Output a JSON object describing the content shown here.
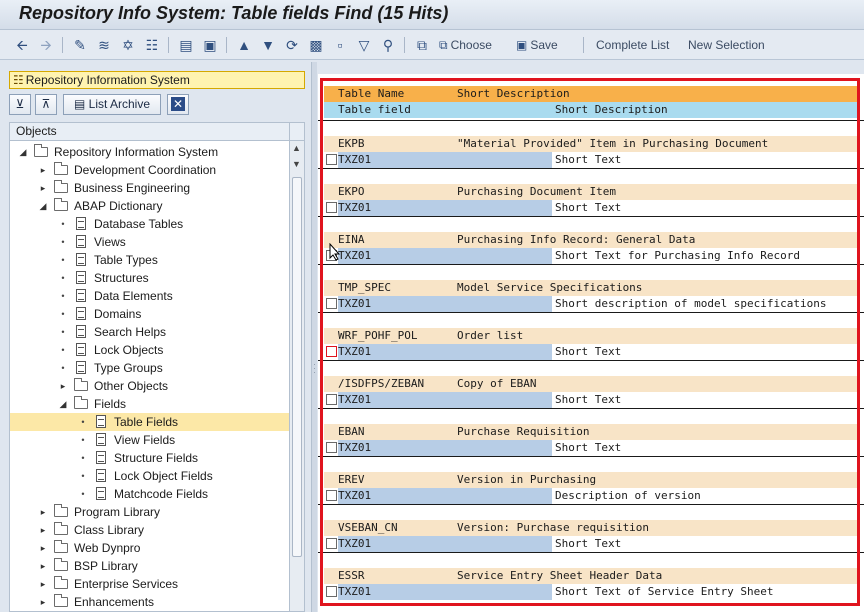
{
  "window": {
    "title": "Repository Info System: Table fields Find (15 Hits)"
  },
  "toolbar": {
    "choose_label": "Choose",
    "save_label": "Save",
    "complete_list_label": "Complete List",
    "new_selection_label": "New Selection"
  },
  "left_panel": {
    "system_label": "Repository Information System",
    "list_archive_label": "List Archive",
    "objects_header": "Objects"
  },
  "tree": [
    {
      "label": "Repository Information System",
      "level": 0,
      "kind": "folder",
      "state": "open"
    },
    {
      "label": "Development Coordination",
      "level": 1,
      "kind": "folder",
      "state": "closed"
    },
    {
      "label": "Business Engineering",
      "level": 1,
      "kind": "folder",
      "state": "closed"
    },
    {
      "label": "ABAP Dictionary",
      "level": 1,
      "kind": "folder",
      "state": "open"
    },
    {
      "label": "Database Tables",
      "level": 2,
      "kind": "doc"
    },
    {
      "label": "Views",
      "level": 2,
      "kind": "doc"
    },
    {
      "label": "Table Types",
      "level": 2,
      "kind": "doc"
    },
    {
      "label": "Structures",
      "level": 2,
      "kind": "doc"
    },
    {
      "label": "Data Elements",
      "level": 2,
      "kind": "doc"
    },
    {
      "label": "Domains",
      "level": 2,
      "kind": "doc"
    },
    {
      "label": "Search Helps",
      "level": 2,
      "kind": "doc"
    },
    {
      "label": "Lock Objects",
      "level": 2,
      "kind": "doc"
    },
    {
      "label": "Type Groups",
      "level": 2,
      "kind": "doc"
    },
    {
      "label": "Other Objects",
      "level": 2,
      "kind": "folder",
      "state": "closed"
    },
    {
      "label": "Fields",
      "level": 2,
      "kind": "folder",
      "state": "open"
    },
    {
      "label": "Table Fields",
      "level": 3,
      "kind": "doc",
      "selected": true
    },
    {
      "label": "View Fields",
      "level": 3,
      "kind": "doc"
    },
    {
      "label": "Structure Fields",
      "level": 3,
      "kind": "doc"
    },
    {
      "label": "Lock Object Fields",
      "level": 3,
      "kind": "doc"
    },
    {
      "label": "Matchcode Fields",
      "level": 3,
      "kind": "doc"
    },
    {
      "label": "Program Library",
      "level": 1,
      "kind": "folder",
      "state": "closed"
    },
    {
      "label": "Class Library",
      "level": 1,
      "kind": "folder",
      "state": "closed"
    },
    {
      "label": "Web Dynpro",
      "level": 1,
      "kind": "folder",
      "state": "closed"
    },
    {
      "label": "BSP Library",
      "level": 1,
      "kind": "folder",
      "state": "closed"
    },
    {
      "label": "Enterprise Services",
      "level": 1,
      "kind": "folder",
      "state": "closed"
    },
    {
      "label": "Enhancements",
      "level": 1,
      "kind": "folder",
      "state": "closed"
    }
  ],
  "list": {
    "header1": {
      "col1": "Table Name",
      "col2": "Short Description"
    },
    "header2": {
      "col1": "Table field",
      "col2": "Short Description"
    },
    "entries": [
      {
        "table": "EKPB",
        "table_desc": "\"Material Provided\" Item in Purchasing Document",
        "field": "TXZ01",
        "field_desc": "Short Text"
      },
      {
        "table": "EKPO",
        "table_desc": "Purchasing Document Item",
        "field": "TXZ01",
        "field_desc": "Short Text"
      },
      {
        "table": "EINA",
        "table_desc": "Purchasing Info Record: General Data",
        "field": "TXZ01",
        "field_desc": "Short Text for Purchasing Info Record"
      },
      {
        "table": "TMP_SPEC",
        "table_desc": "Model Service Specifications",
        "field": "TXZ01",
        "field_desc": "Short description of model specifications"
      },
      {
        "table": "WRF_POHF_POL",
        "table_desc": "Order list",
        "field": "TXZ01",
        "field_desc": "Short Text"
      },
      {
        "table": "/ISDFPS/ZEBAN",
        "table_desc": "Copy of EBAN",
        "field": "TXZ01",
        "field_desc": "Short Text"
      },
      {
        "table": "EBAN",
        "table_desc": "Purchase Requisition",
        "field": "TXZ01",
        "field_desc": "Short Text"
      },
      {
        "table": "EREV",
        "table_desc": "Version in Purchasing",
        "field": "TXZ01",
        "field_desc": "Description of version"
      },
      {
        "table": "VSEBAN_CN",
        "table_desc": "Version: Purchase requisition",
        "field": "TXZ01",
        "field_desc": "Short Text"
      },
      {
        "table": "ESSR",
        "table_desc": "Service Entry Sheet Header Data",
        "field": "TXZ01",
        "field_desc": "Short Text of Service Entry Sheet"
      }
    ]
  },
  "colors": {
    "header_orange": "#f8b04a",
    "header_blue": "#a9dbef",
    "table_row": "#f8e4c7",
    "field_cell": "#b7cde6",
    "selection": "#fce8a7",
    "highlight_frame": "#e0141e"
  }
}
